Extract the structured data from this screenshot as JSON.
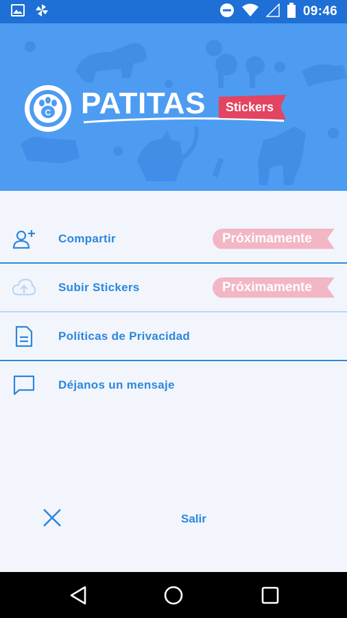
{
  "status_bar": {
    "time": "09:46",
    "icons": [
      "image-icon",
      "pinwheel-icon",
      "do-not-disturb-icon",
      "wifi-icon",
      "signal-icon",
      "battery-icon"
    ]
  },
  "header": {
    "app_name": "PATITAS",
    "ribbon_label": "Stickers",
    "colors": {
      "banner": "#4d9cf2",
      "status_bar": "#1e6fd6",
      "ribbon": "#e34461"
    }
  },
  "menu": {
    "items": [
      {
        "label": "Compartir",
        "icon": "add-person-icon",
        "badge": "Próximamente"
      },
      {
        "label": "Subir Stickers",
        "icon": "cloud-upload-icon",
        "badge": "Próximamente"
      },
      {
        "label": "Políticas de Privacidad",
        "icon": "document-icon"
      },
      {
        "label": "Déjanos un mensaje",
        "icon": "message-icon"
      }
    ]
  },
  "exit": {
    "label": "Salir",
    "icon": "close-icon"
  },
  "nav_bar": {
    "icons": [
      "back-icon",
      "home-icon",
      "recents-icon"
    ]
  },
  "colors": {
    "accent": "#2c86dd",
    "badge": "#f2b6c4"
  }
}
